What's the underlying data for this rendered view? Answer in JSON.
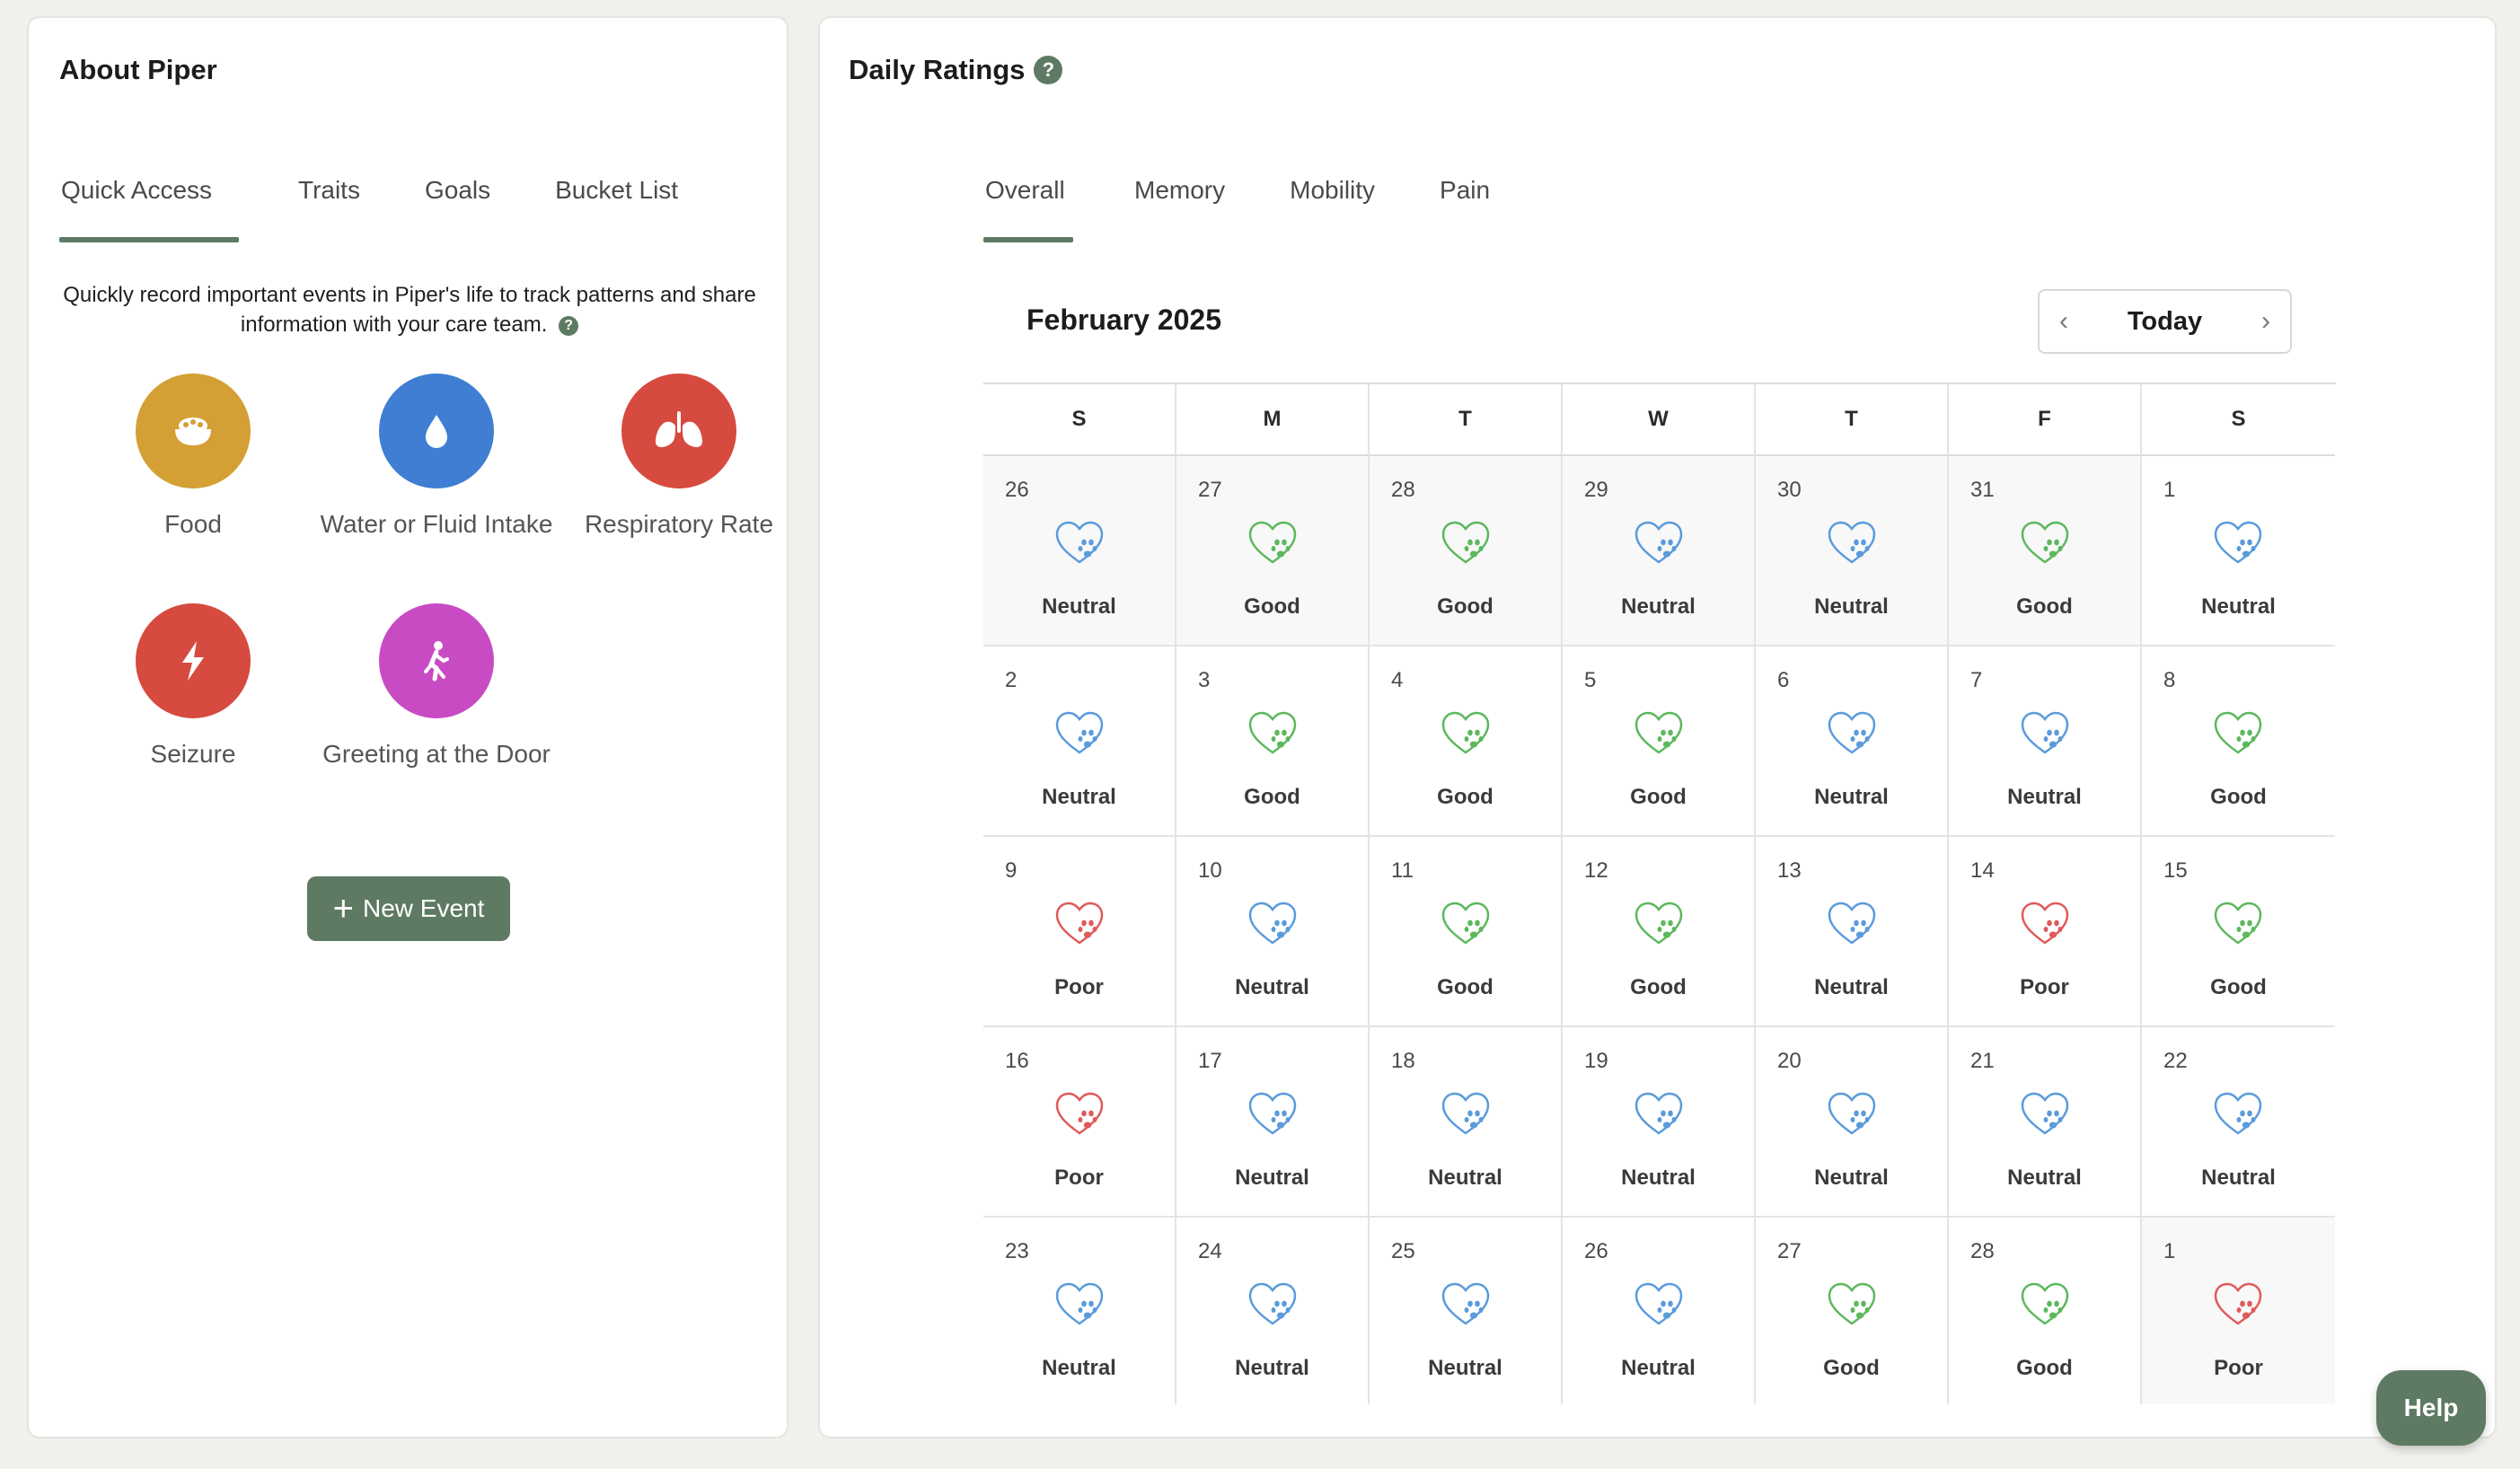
{
  "about": {
    "title": "About Piper",
    "tabs": [
      "Quick Access",
      "Traits",
      "Goals",
      "Bucket List"
    ],
    "description": "Quickly record important events in Piper's life to track patterns and share information with your care team.",
    "quick_access": [
      {
        "label": "Food",
        "icon": "food-bowl-icon",
        "color": "#d4a035"
      },
      {
        "label": "Water or Fluid Intake",
        "icon": "water-drop-icon",
        "color": "#3f7ed2"
      },
      {
        "label": "Respiratory Rate",
        "icon": "lungs-icon",
        "color": "#d64a3f"
      },
      {
        "label": "Seizure",
        "icon": "lightning-icon",
        "color": "#d64a3f"
      },
      {
        "label": "Greeting at the Door",
        "icon": "walking-person-icon",
        "color": "#c84bc4"
      }
    ],
    "new_event_label": "New Event"
  },
  "ratings": {
    "title": "Daily Ratings",
    "help_glyph": "?",
    "tabs": [
      "Overall",
      "Memory",
      "Mobility",
      "Pain"
    ],
    "month_label": "February 2025",
    "today_label": "Today",
    "weekdays": [
      "S",
      "M",
      "T",
      "W",
      "T",
      "F",
      "S"
    ],
    "colors": {
      "Good": "#5cb85c",
      "Neutral": "#5a9bdc",
      "Poor": "#e05a5a"
    },
    "weeks": [
      [
        {
          "d": "26",
          "r": "Neutral",
          "o": true
        },
        {
          "d": "27",
          "r": "Good",
          "o": true
        },
        {
          "d": "28",
          "r": "Good",
          "o": true
        },
        {
          "d": "29",
          "r": "Neutral",
          "o": true
        },
        {
          "d": "30",
          "r": "Neutral",
          "o": true
        },
        {
          "d": "31",
          "r": "Good",
          "o": true
        },
        {
          "d": "1",
          "r": "Neutral",
          "o": false
        }
      ],
      [
        {
          "d": "2",
          "r": "Neutral",
          "o": false
        },
        {
          "d": "3",
          "r": "Good",
          "o": false
        },
        {
          "d": "4",
          "r": "Good",
          "o": false
        },
        {
          "d": "5",
          "r": "Good",
          "o": false
        },
        {
          "d": "6",
          "r": "Neutral",
          "o": false
        },
        {
          "d": "7",
          "r": "Neutral",
          "o": false
        },
        {
          "d": "8",
          "r": "Good",
          "o": false
        }
      ],
      [
        {
          "d": "9",
          "r": "Poor",
          "o": false
        },
        {
          "d": "10",
          "r": "Neutral",
          "o": false
        },
        {
          "d": "11",
          "r": "Good",
          "o": false
        },
        {
          "d": "12",
          "r": "Good",
          "o": false
        },
        {
          "d": "13",
          "r": "Neutral",
          "o": false
        },
        {
          "d": "14",
          "r": "Poor",
          "o": false
        },
        {
          "d": "15",
          "r": "Good",
          "o": false
        }
      ],
      [
        {
          "d": "16",
          "r": "Poor",
          "o": false
        },
        {
          "d": "17",
          "r": "Neutral",
          "o": false
        },
        {
          "d": "18",
          "r": "Neutral",
          "o": false
        },
        {
          "d": "19",
          "r": "Neutral",
          "o": false
        },
        {
          "d": "20",
          "r": "Neutral",
          "o": false
        },
        {
          "d": "21",
          "r": "Neutral",
          "o": false
        },
        {
          "d": "22",
          "r": "Neutral",
          "o": false
        }
      ],
      [
        {
          "d": "23",
          "r": "Neutral",
          "o": false
        },
        {
          "d": "24",
          "r": "Neutral",
          "o": false
        },
        {
          "d": "25",
          "r": "Neutral",
          "o": false
        },
        {
          "d": "26",
          "r": "Neutral",
          "o": false
        },
        {
          "d": "27",
          "r": "Good",
          "o": false
        },
        {
          "d": "28",
          "r": "Good",
          "o": false
        },
        {
          "d": "1",
          "r": "Poor",
          "o": true
        }
      ]
    ]
  },
  "help_button_label": "Help"
}
